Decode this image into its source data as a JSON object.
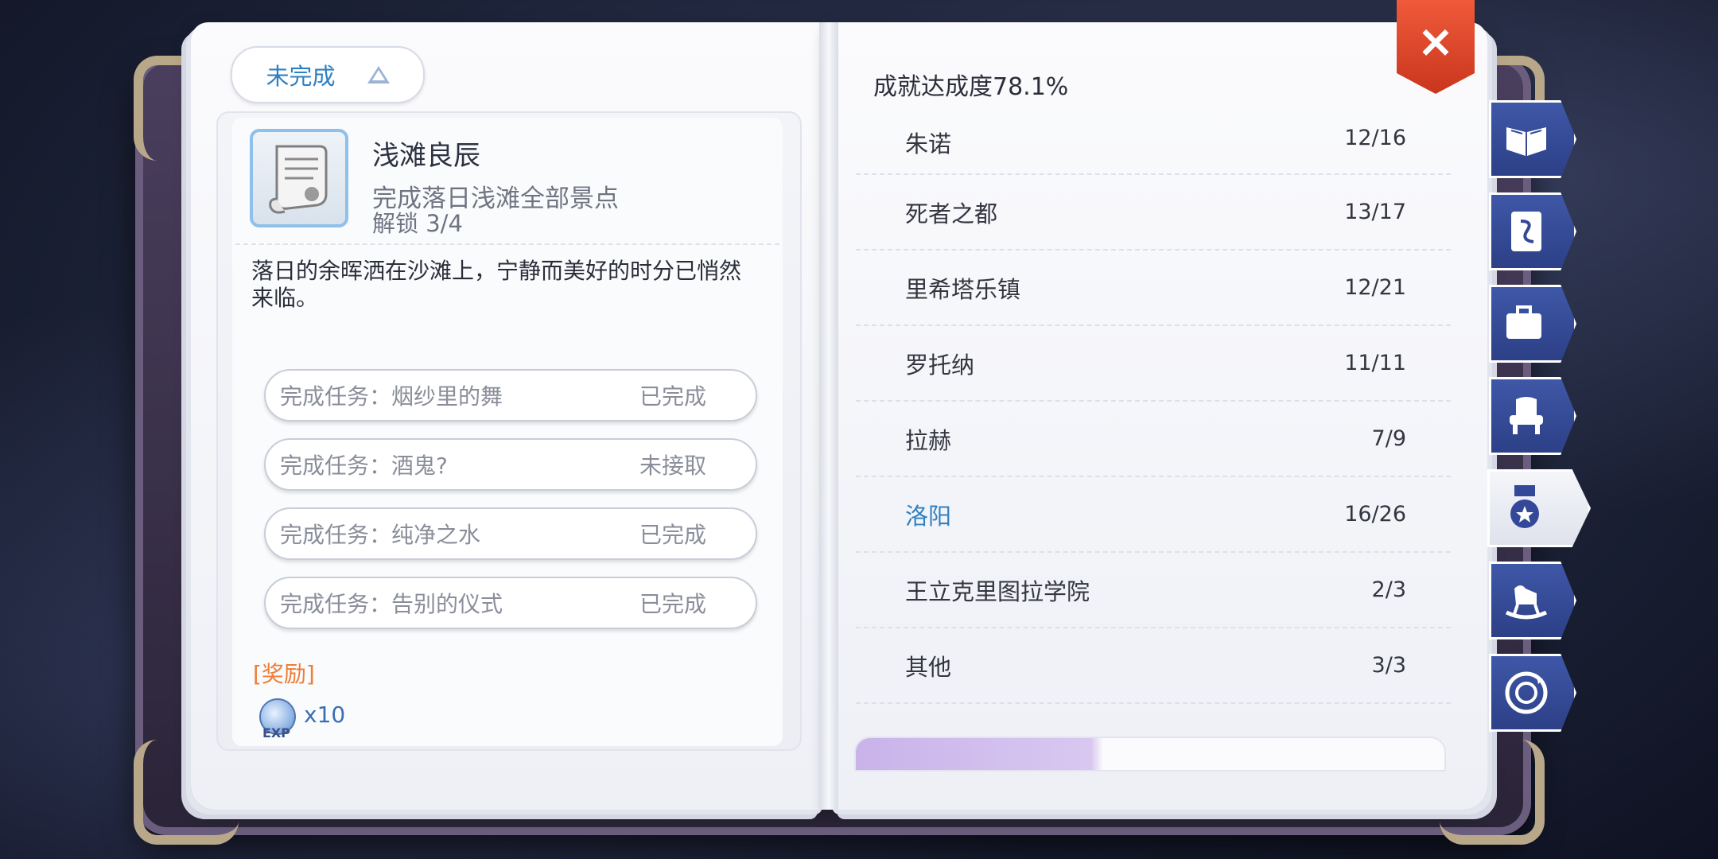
{
  "left_page": {
    "filter": {
      "label": "未完成"
    },
    "achievement": {
      "title": "浅滩良辰",
      "description": "完成落日浅滩全部景点",
      "unlock": "解锁 3/4",
      "flavor": "落日的余晖洒在沙滩上，宁静而美好的时分已悄然来临。",
      "tasks": [
        {
          "name": "完成任务：烟纱里的舞",
          "status": "已完成"
        },
        {
          "name": "完成任务：酒鬼?",
          "status": "未接取"
        },
        {
          "name": "完成任务：纯净之水",
          "status": "已完成"
        },
        {
          "name": "完成任务：告别的仪式",
          "status": "已完成"
        }
      ],
      "reward_label": "[奖励]",
      "reward": {
        "icon_text": "EXP",
        "quantity": "x10"
      }
    }
  },
  "right_page": {
    "overall": "成就达成度78.1%",
    "areas": [
      {
        "name": "朱诺",
        "count": "12/16"
      },
      {
        "name": "死者之都",
        "count": "13/17"
      },
      {
        "name": "里希塔乐镇",
        "count": "12/21"
      },
      {
        "name": "罗托纳",
        "count": "11/11"
      },
      {
        "name": "拉赫",
        "count": "7/9"
      },
      {
        "name": "洛阳",
        "count": "16/26"
      },
      {
        "name": "王立克里图拉学院",
        "count": "2/3"
      },
      {
        "name": "其他",
        "count": "3/3"
      }
    ]
  },
  "close": {
    "label": "×"
  },
  "colors": {
    "accent": "#2f80c2",
    "reward": "#ef7d38",
    "close": "#e04a2c",
    "tab": "#34489a"
  },
  "tabs": [
    {
      "icon": "open-book-icon"
    },
    {
      "icon": "card-icon"
    },
    {
      "icon": "briefcase-heart-icon"
    },
    {
      "icon": "armchair-icon"
    },
    {
      "icon": "medal-icon",
      "active": true
    },
    {
      "icon": "rocking-horse-icon"
    },
    {
      "icon": "circular-arrows-icon"
    }
  ]
}
